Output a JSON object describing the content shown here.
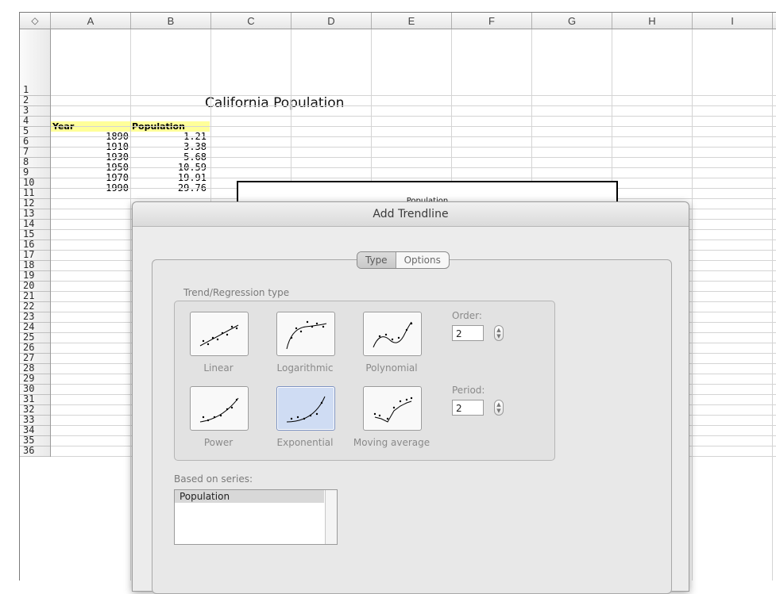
{
  "sheet": {
    "corner_icon": "select-all-arrows-icon",
    "columns": [
      "A",
      "B",
      "C",
      "D",
      "E",
      "F",
      "G",
      "H",
      "I"
    ],
    "rows": [
      "1",
      "2",
      "3",
      "4",
      "5",
      "6",
      "7",
      "8",
      "9",
      "10",
      "11",
      "12",
      "13",
      "14",
      "15",
      "16",
      "17",
      "18",
      "19",
      "20",
      "21",
      "22",
      "23",
      "24",
      "25",
      "26",
      "27",
      "28",
      "29",
      "30",
      "31",
      "32",
      "33",
      "34",
      "35",
      "36"
    ],
    "title": "California Population",
    "header_year": "Year",
    "header_population": "Population",
    "data": [
      {
        "year": "1890",
        "population": "1.21"
      },
      {
        "year": "1910",
        "population": "3.38"
      },
      {
        "year": "1930",
        "population": "5.68"
      },
      {
        "year": "1950",
        "population": "10.59"
      },
      {
        "year": "1970",
        "population": "19.91"
      },
      {
        "year": "1990",
        "population": "29.76"
      }
    ],
    "header_color": "#ffff99"
  },
  "chart": {
    "title": "Population"
  },
  "dialog": {
    "title": "Add Trendline",
    "tabs": [
      {
        "label": "Type",
        "selected": true
      },
      {
        "label": "Options",
        "selected": false
      }
    ],
    "group_label": "Trend/Regression type",
    "types": [
      {
        "label": "Linear",
        "icon": "linear-trend-icon",
        "selected": false
      },
      {
        "label": "Logarithmic",
        "icon": "logarithmic-trend-icon",
        "selected": false
      },
      {
        "label": "Polynomial",
        "icon": "polynomial-trend-icon",
        "selected": false
      },
      {
        "label": "Power",
        "icon": "power-trend-icon",
        "selected": false
      },
      {
        "label": "Exponential",
        "icon": "exponential-trend-icon",
        "selected": true
      },
      {
        "label": "Moving average",
        "icon": "moving-average-trend-icon",
        "selected": false
      }
    ],
    "order_label": "Order:",
    "order_value": "2",
    "period_label": "Period:",
    "period_value": "2",
    "series_label": "Based on series:",
    "series": [
      "Population"
    ],
    "selection_color": "#cfdcf3"
  }
}
